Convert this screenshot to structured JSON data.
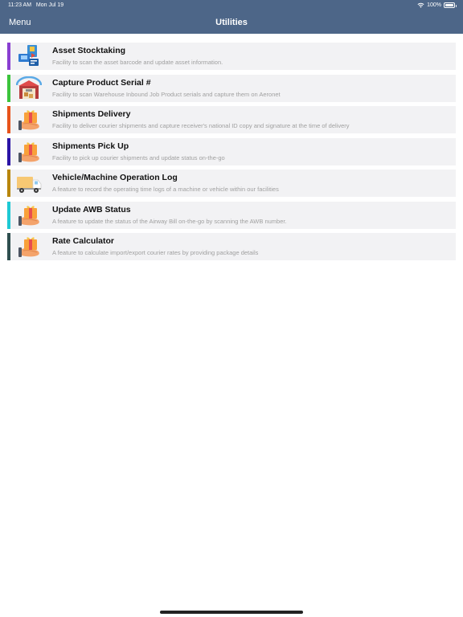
{
  "status_bar": {
    "time": "11:23 AM",
    "date": "Mon Jul 19",
    "battery": "100%",
    "battery_level": 1.0
  },
  "header": {
    "menu_label": "Menu",
    "title": "Utilities",
    "background": "#4d6688"
  },
  "items": [
    {
      "title": "Asset Stocktaking",
      "description": "Facility to scan the asset barcode and update asset information.",
      "accent": "#8a3fd1",
      "icon": "asset-scan-icon"
    },
    {
      "title": "Capture Product Serial #",
      "description": "Facility to scan Warehouse Inbound Job Product serials and capture them on Aeronet",
      "accent": "#3cc43c",
      "icon": "warehouse-icon"
    },
    {
      "title": "Shipments Delivery",
      "description": "Facility to deliver courier shipments and capture receiver's national ID copy and signature at the time of delivery",
      "accent": "#e8531b",
      "icon": "package-hand-icon"
    },
    {
      "title": "Shipments Pick Up",
      "description": "Facility to pick up courier shipments and update status on-the-go",
      "accent": "#2b14a6",
      "icon": "package-hand-icon"
    },
    {
      "title": "Vehicle/Machine Operation Log",
      "description": "A feature to record the operating time logs of a machine or vehicle within our facilities",
      "accent": "#b8860b",
      "icon": "truck-icon"
    },
    {
      "title": "Update AWB Status",
      "description": "A feature to update the status of the Airway Bill on-the-go by scanning the AWB number.",
      "accent": "#1ec9d4",
      "icon": "package-hand-icon"
    },
    {
      "title": "Rate Calculator",
      "description": "A feature to calculate import/export courier rates by providing package details",
      "accent": "#2f4f4f",
      "icon": "package-hand-icon"
    }
  ]
}
